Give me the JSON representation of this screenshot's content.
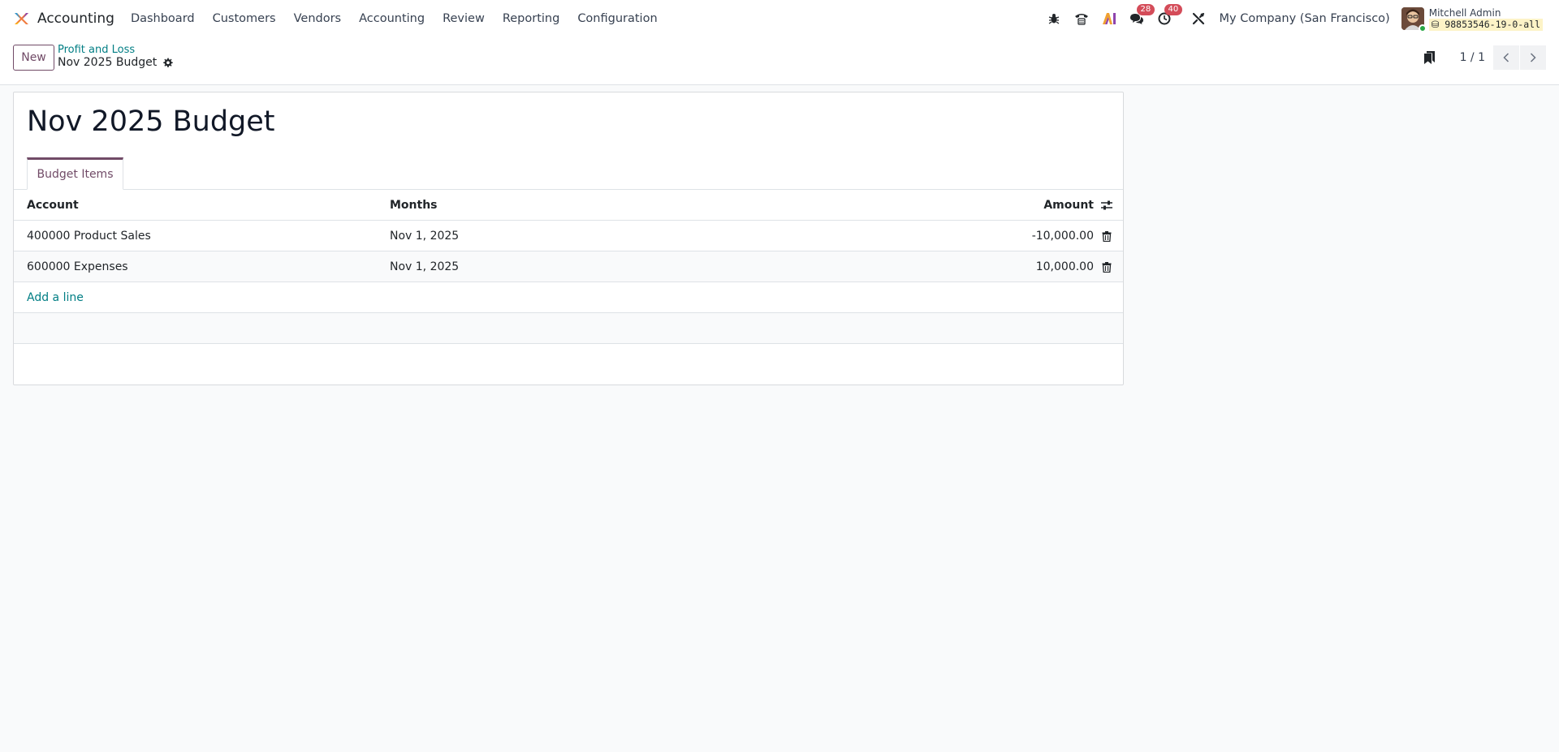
{
  "navbar": {
    "app_name": "Accounting",
    "menu": [
      "Dashboard",
      "Customers",
      "Vendors",
      "Accounting",
      "Review",
      "Reporting",
      "Configuration"
    ],
    "messages_badge": "28",
    "activities_badge": "40",
    "company": "My Company (San Francisco)",
    "user_name": "Mitchell Admin",
    "database": "98853546-19-0-all"
  },
  "control": {
    "new_label": "New",
    "breadcrumb_parent": "Profit and Loss",
    "breadcrumb_current": "Nov 2025 Budget",
    "pager": "1 / 1"
  },
  "form": {
    "title": "Nov 2025 Budget",
    "tab_label": "Budget Items",
    "columns": {
      "account": "Account",
      "months": "Months",
      "amount": "Amount"
    },
    "rows": [
      {
        "account": "400000 Product Sales",
        "months": "Nov 1, 2025",
        "amount": "-10,000.00"
      },
      {
        "account": "600000 Expenses",
        "months": "Nov 1, 2025",
        "amount": "10,000.00"
      }
    ],
    "add_line": "Add a line"
  },
  "colors": {
    "brand": "#714b67",
    "link": "#017e84",
    "badge": "#d44c59"
  }
}
